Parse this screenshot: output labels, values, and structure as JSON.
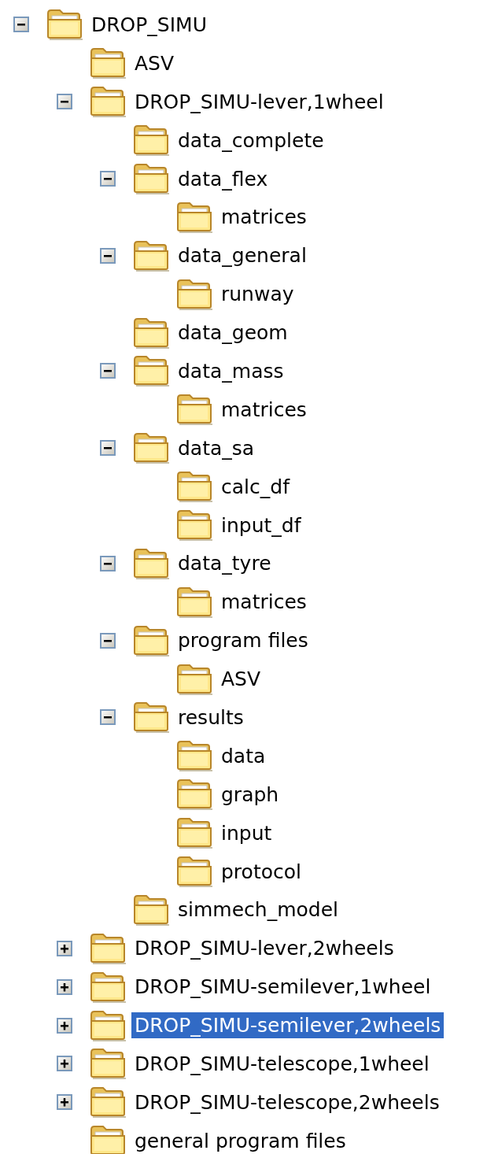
{
  "tree": [
    {
      "label": "DROP_SIMU",
      "expanded": true,
      "selected": false,
      "children": [
        {
          "label": "ASV",
          "selected": false
        },
        {
          "label": "DROP_SIMU-lever,1wheel",
          "expanded": true,
          "selected": false,
          "children": [
            {
              "label": "data_complete",
              "selected": false
            },
            {
              "label": "data_flex",
              "expanded": true,
              "selected": false,
              "children": [
                {
                  "label": "matrices",
                  "selected": false
                }
              ]
            },
            {
              "label": "data_general",
              "expanded": true,
              "selected": false,
              "children": [
                {
                  "label": "runway",
                  "selected": false
                }
              ]
            },
            {
              "label": "data_geom",
              "selected": false
            },
            {
              "label": "data_mass",
              "expanded": true,
              "selected": false,
              "children": [
                {
                  "label": "matrices",
                  "selected": false
                }
              ]
            },
            {
              "label": "data_sa",
              "expanded": true,
              "selected": false,
              "children": [
                {
                  "label": "calc_df",
                  "selected": false
                },
                {
                  "label": "input_df",
                  "selected": false
                }
              ]
            },
            {
              "label": "data_tyre",
              "expanded": true,
              "selected": false,
              "children": [
                {
                  "label": "matrices",
                  "selected": false
                }
              ]
            },
            {
              "label": "program files",
              "expanded": true,
              "selected": false,
              "children": [
                {
                  "label": "ASV",
                  "selected": false
                }
              ]
            },
            {
              "label": "results",
              "expanded": true,
              "selected": false,
              "children": [
                {
                  "label": "data",
                  "selected": false
                },
                {
                  "label": "graph",
                  "selected": false
                },
                {
                  "label": "input",
                  "selected": false
                },
                {
                  "label": "protocol",
                  "selected": false
                }
              ]
            },
            {
              "label": "simmech_model",
              "selected": false
            }
          ]
        },
        {
          "label": "DROP_SIMU-lever,2wheels",
          "expanded": false,
          "selected": false
        },
        {
          "label": "DROP_SIMU-semilever,1wheel",
          "expanded": false,
          "selected": false
        },
        {
          "label": "DROP_SIMU-semilever,2wheels",
          "expanded": false,
          "selected": true
        },
        {
          "label": "DROP_SIMU-telescope,1wheel",
          "expanded": false,
          "selected": false
        },
        {
          "label": "DROP_SIMU-telescope,2wheels",
          "expanded": false,
          "selected": false
        },
        {
          "label": "general program files",
          "selected": false
        }
      ]
    }
  ]
}
